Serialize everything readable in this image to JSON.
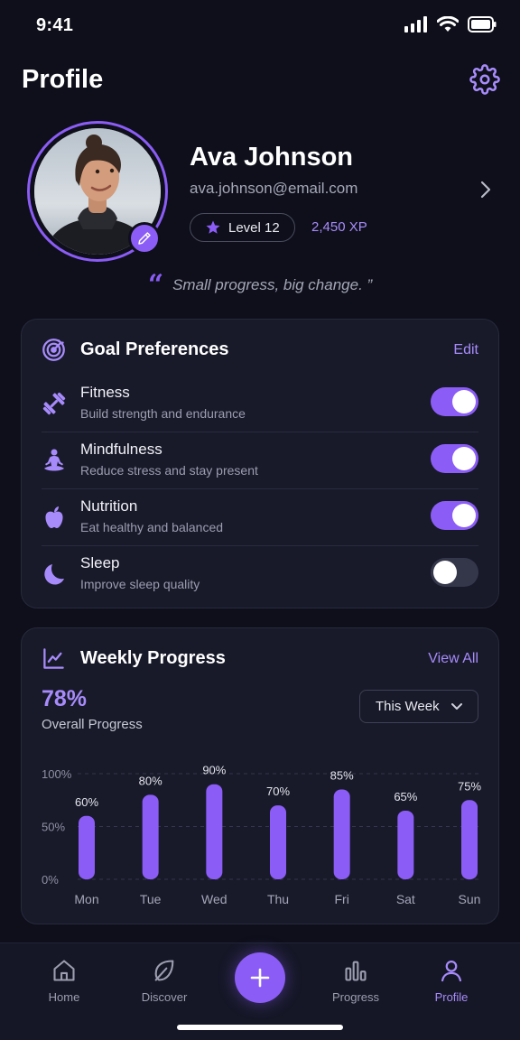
{
  "status_bar": {
    "time": "9:41"
  },
  "header": {
    "title": "Profile"
  },
  "profile": {
    "name": "Ava Johnson",
    "email": "ava.johnson@email.com",
    "level": "Level 12",
    "xp": "2,450 XP",
    "quote": "Small progress, big change. ”"
  },
  "goals": {
    "title": "Goal Preferences",
    "edit_label": "Edit",
    "items": [
      {
        "title": "Fitness",
        "subtitle": "Build strength and endurance",
        "enabled": true,
        "icon": "dumbbell-icon"
      },
      {
        "title": "Mindfulness",
        "subtitle": "Reduce stress and stay present",
        "enabled": true,
        "icon": "meditation-icon"
      },
      {
        "title": "Nutrition",
        "subtitle": "Eat healthy and balanced",
        "enabled": true,
        "icon": "apple-icon"
      },
      {
        "title": "Sleep",
        "subtitle": "Improve sleep quality",
        "enabled": false,
        "icon": "moon-icon"
      }
    ]
  },
  "progress": {
    "title": "Weekly Progress",
    "view_all_label": "View All",
    "overall_value": "78%",
    "overall_label": "Overall Progress",
    "period_selected": "This Week"
  },
  "chart_data": {
    "type": "bar",
    "categories": [
      "Mon",
      "Tue",
      "Wed",
      "Thu",
      "Fri",
      "Sat",
      "Sun"
    ],
    "values": [
      60,
      80,
      90,
      70,
      85,
      65,
      75
    ],
    "data_labels": [
      "60%",
      "80%",
      "90%",
      "70%",
      "85%",
      "65%",
      "75%"
    ],
    "y_ticks": [
      "100%",
      "50%",
      "0%"
    ],
    "ylim": [
      0,
      100
    ],
    "bar_color": "#8b5cf6",
    "grid": true
  },
  "nav": {
    "items": [
      {
        "label": "Home",
        "icon": "home-icon",
        "active": false
      },
      {
        "label": "Discover",
        "icon": "leaf-icon",
        "active": false
      },
      {
        "label": "Progress",
        "icon": "bar-chart-icon",
        "active": false
      },
      {
        "label": "Profile",
        "icon": "person-icon",
        "active": true
      }
    ],
    "add_icon": "plus-icon"
  },
  "colors": {
    "accent": "#8b5cf6",
    "accent_light": "#a78bfa",
    "background": "#0e0f1a",
    "card": "#181a2a"
  }
}
